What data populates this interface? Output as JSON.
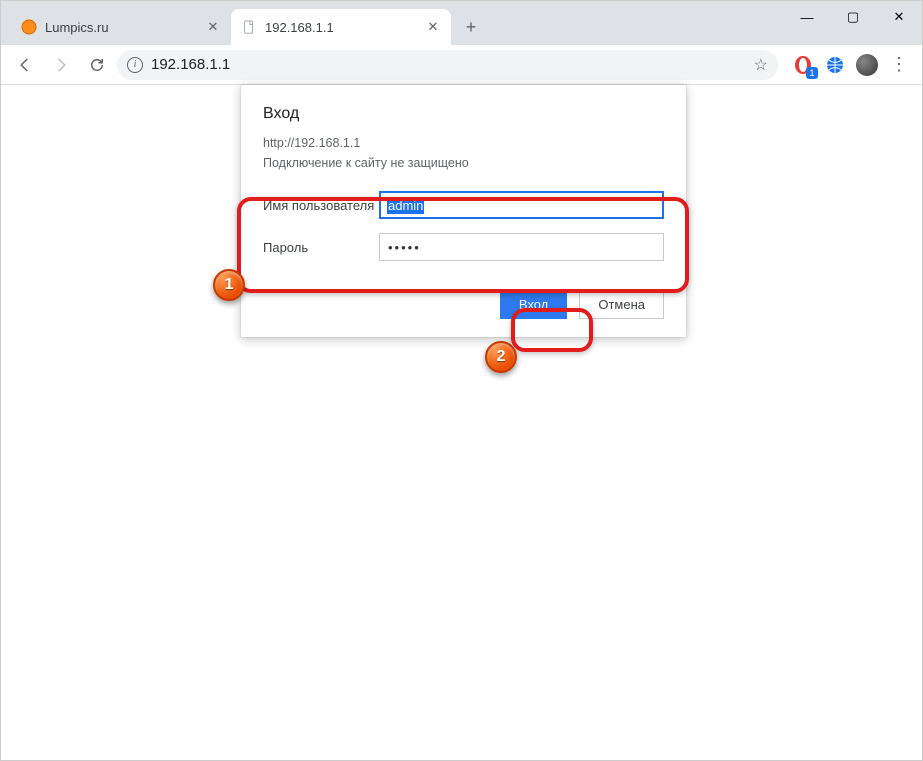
{
  "window": {
    "controls": {
      "min": "—",
      "max": "▢",
      "close": "✕"
    }
  },
  "tabs": [
    {
      "title": "Lumpics.ru",
      "active": false,
      "favicon": "orange-circle"
    },
    {
      "title": "192.168.1.1",
      "active": true,
      "favicon": "blank-page"
    }
  ],
  "new_tab_label": "+",
  "nav": {
    "back": "←",
    "forward": "→",
    "reload": "⟳"
  },
  "omnibox": {
    "info": "i",
    "url": "192.168.1.1",
    "star": "☆"
  },
  "extensions": {
    "ext1_badge": "1"
  },
  "dialog": {
    "title": "Вход",
    "origin": "http://192.168.1.1",
    "warning": "Подключение к сайту не защищено",
    "username_label": "Имя пользователя",
    "username_value": "admin",
    "password_label": "Пароль",
    "password_value": "•••••",
    "submit": "Вход",
    "cancel": "Отмена"
  },
  "annotations": {
    "badge1": "1",
    "badge2": "2"
  }
}
